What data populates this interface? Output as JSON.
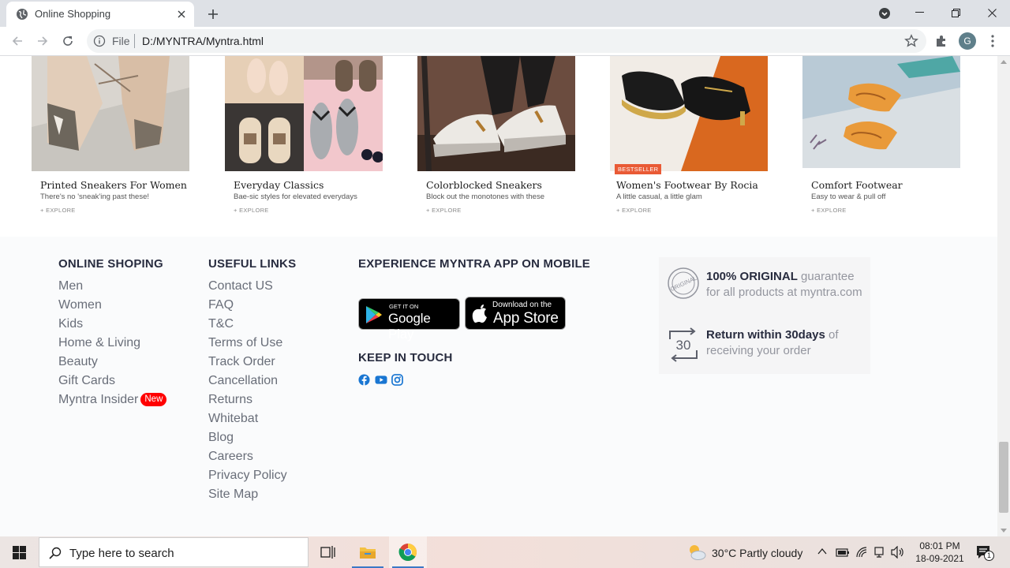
{
  "browser": {
    "tab_title": "Online Shopping",
    "omnibox_scheme": "File",
    "omnibox_url": "D:/MYNTRA/Myntra.html",
    "profile_initial": "G"
  },
  "products": [
    {
      "name": "Printed Sneakers For Women",
      "subtitle": "There's no 'sneak'ing past these!",
      "cta": "+ EXPLORE",
      "badge": ""
    },
    {
      "name": "Everyday Classics",
      "subtitle": "Bae-sic styles for elevated everydays",
      "cta": "+ EXPLORE",
      "badge": ""
    },
    {
      "name": "Colorblocked Sneakers",
      "subtitle": "Block out the monotones with these",
      "cta": "+ EXPLORE",
      "badge": ""
    },
    {
      "name": "Women's Footwear By Rocia",
      "subtitle": "A little casual, a little glam",
      "cta": "+ EXPLORE",
      "badge": "BESTSELLER"
    },
    {
      "name": "Comfort Footwear",
      "subtitle": "Easy to wear & pull off",
      "cta": "+ EXPLORE",
      "badge": ""
    }
  ],
  "footer": {
    "online_shopping": {
      "heading": "ONLINE SHOPING",
      "links": [
        "Men",
        "Women",
        "Kids",
        "Home & Living",
        "Beauty",
        "Gift Cards",
        "Myntra Insider"
      ],
      "new_badge": "New"
    },
    "useful_links": {
      "heading": "USEFUL LINKS",
      "links": [
        "Contact US",
        "FAQ",
        "T&C",
        "Terms of Use",
        "Track Order",
        "Cancellation",
        "Returns",
        "Whitebat",
        "Blog",
        "Careers",
        "Privacy Policy",
        "Site Map"
      ]
    },
    "app": {
      "heading": "EXPERIENCE MYNTRA APP ON MOBILE",
      "google_small": "GET IT ON",
      "google_big": "Google Play",
      "apple_small": "Download on the",
      "apple_big": "App Store"
    },
    "keep_in_touch": {
      "heading": "KEEP IN TOUCH",
      "icons": [
        "facebook-icon",
        "youtube-icon",
        "instagram-icon"
      ]
    },
    "promo": {
      "original_bold": "100% ORIGINAL",
      "original_rest": " guarantee",
      "original_line2": "for all products at myntra.com",
      "original_stamp": "ORIGINAL",
      "return_bold": "Return within 30days",
      "return_rest": " of",
      "return_line2": "receiving your order",
      "return_number": "30"
    }
  },
  "taskbar": {
    "search_placeholder": "Type here to search",
    "weather": "30°C  Partly cloudy",
    "time": "08:01 PM",
    "date": "18-09-2021",
    "notification_count": "1"
  },
  "colors": {
    "new_badge": "#ff0000",
    "bestseller_badge": "#e95a35",
    "social_blue": "#1976d2"
  }
}
